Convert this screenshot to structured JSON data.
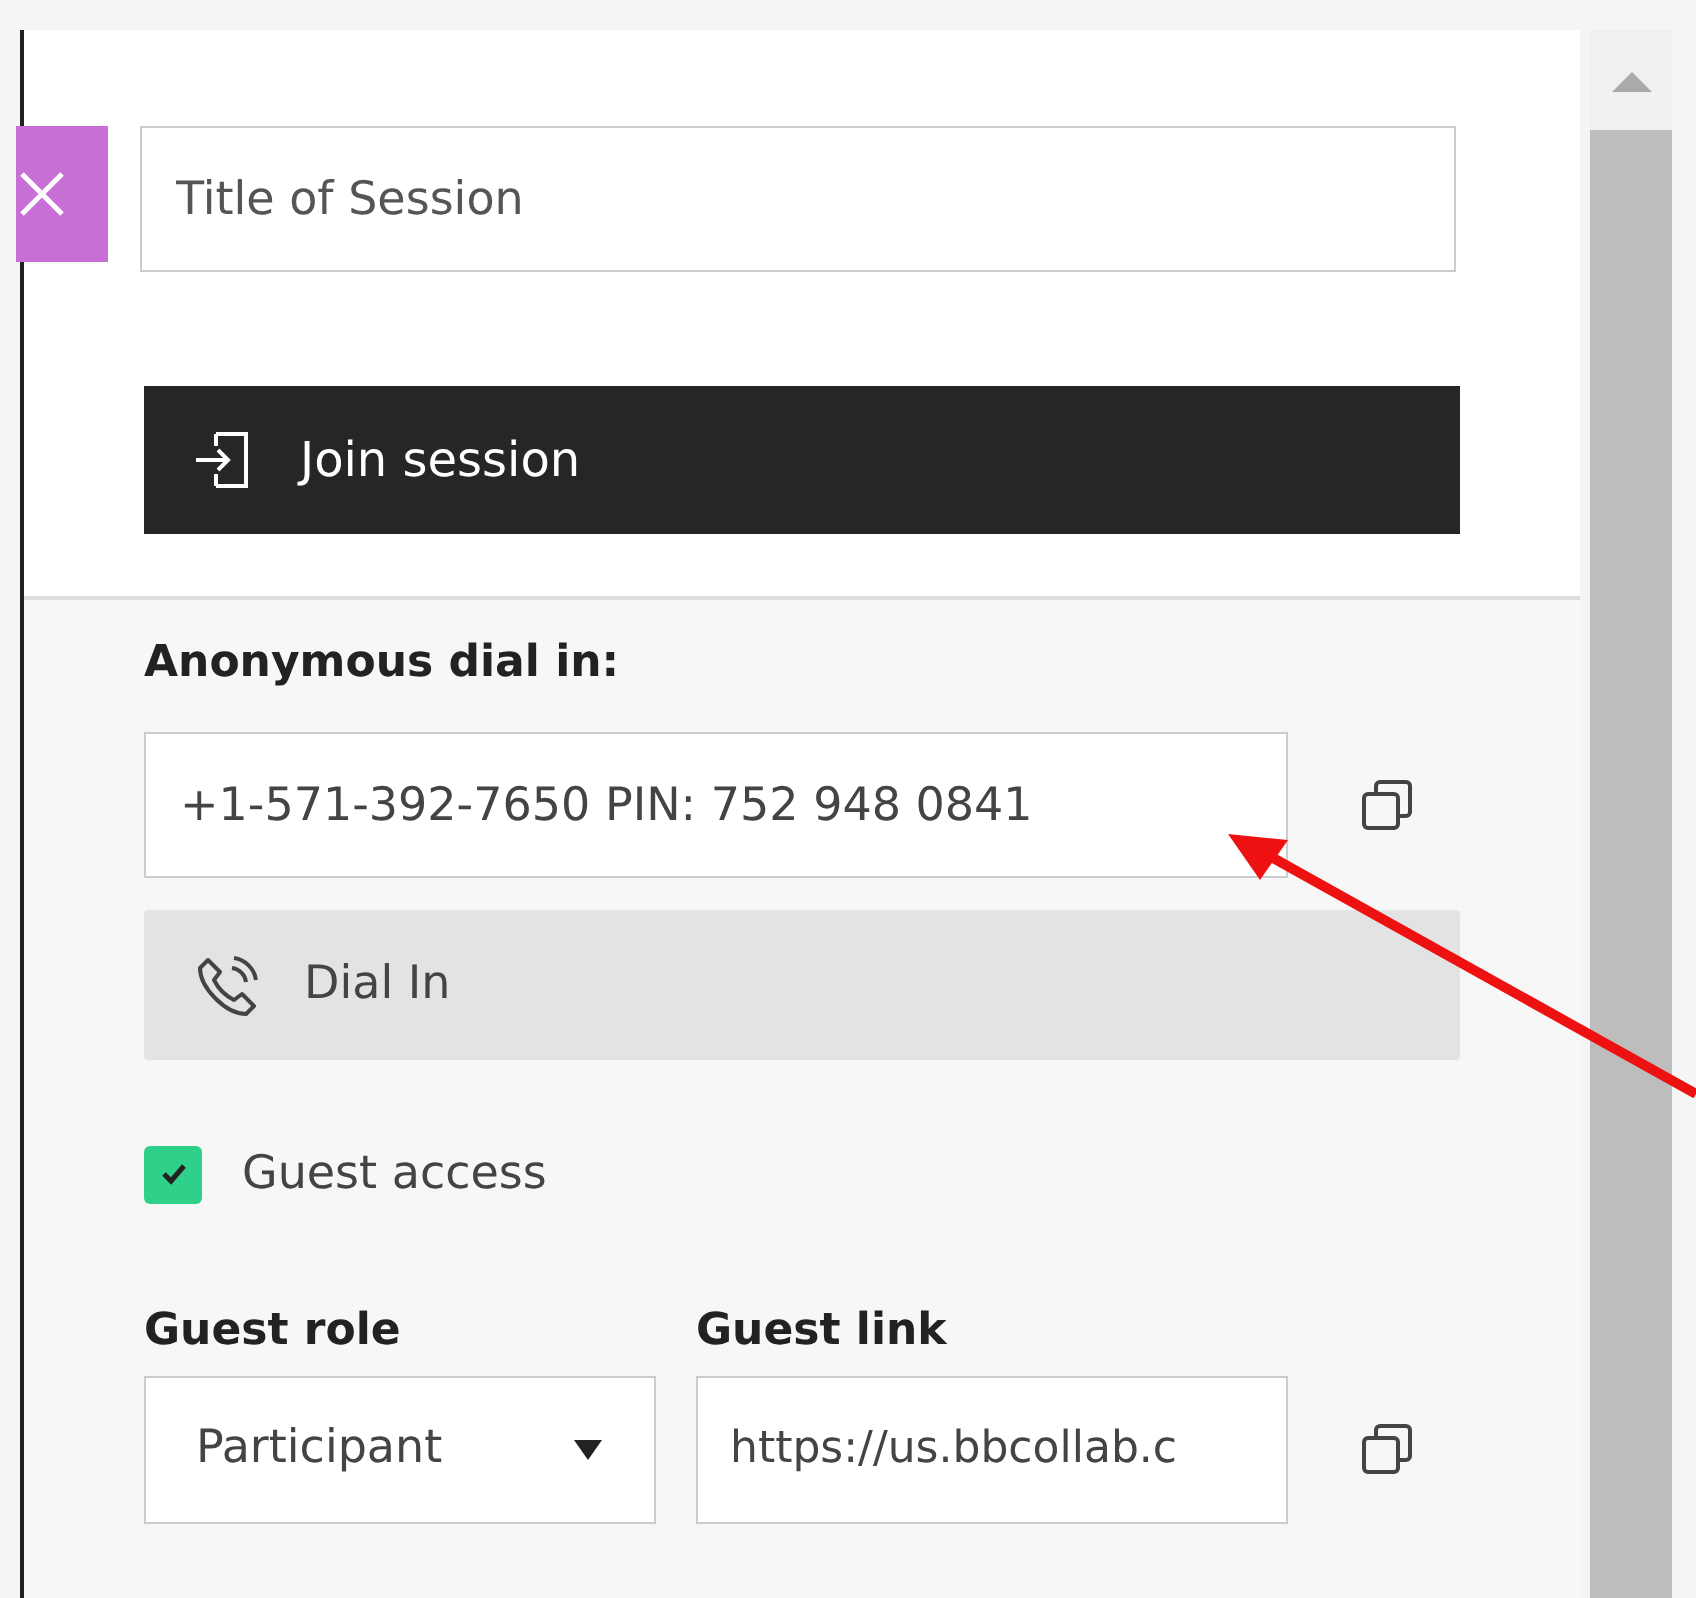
{
  "session_title": {
    "placeholder": "Title of Session"
  },
  "join_button": {
    "label": "Join session"
  },
  "dial_in": {
    "label": "Anonymous dial in:",
    "value": "+1-571-392-7650 PIN: 752 948 0841",
    "button": "Dial In"
  },
  "guest_access": {
    "label": "Guest access",
    "checked": true
  },
  "guest_role": {
    "label": "Guest role",
    "value": "Participant"
  },
  "guest_link": {
    "label": "Guest link",
    "value": "https://us.bbcollab.c"
  }
}
